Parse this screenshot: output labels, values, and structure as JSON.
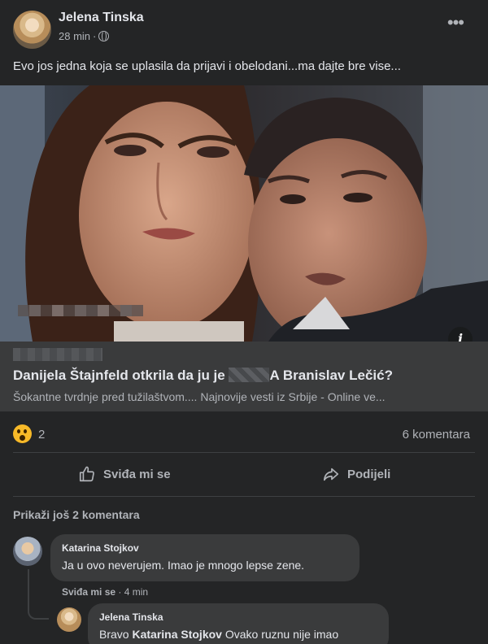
{
  "post": {
    "author": "Jelena Tinska",
    "time": "28 min",
    "separator": "·",
    "text": "Evo jos jedna koja se uplasila da prijavi i obelodani...ma dajte bre vise..."
  },
  "link_preview": {
    "title_part1": "Danijela Štajnfeld otkrila da ju je ",
    "title_part2": "A",
    "title_part3": " Branislav Lečić?",
    "description": "Šokantne tvrdnje pred tužilaštvom.... Najnovije vesti iz Srbije - Online ve..."
  },
  "reactions": {
    "count": "2",
    "comments_label": "6 komentara"
  },
  "actions": {
    "like": "Sviđa mi se",
    "share": "Podijeli"
  },
  "comments": {
    "more_label": "Prikaži još 2 komentara",
    "items": [
      {
        "name": "Katarina Stojkov",
        "text": "Ja u ovo neverujem. Imao je mnogo lepse zene.",
        "like_label": "Sviđa mi se",
        "separator": "·",
        "time": "4 min"
      },
      {
        "name": "Jelena Tinska",
        "text_prefix": "Bravo ",
        "mention": "Katarina Stojkov",
        "text_suffix": " Ovako ruznu nije imao"
      }
    ]
  },
  "colors": {
    "background": "#242526",
    "bubble": "#3a3b3c",
    "text_primary": "#e4e6eb",
    "text_secondary": "#b0b3b8",
    "reaction": "#f7b928"
  }
}
